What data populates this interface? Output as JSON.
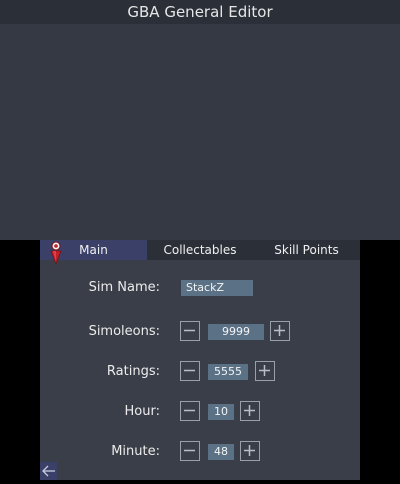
{
  "app": {
    "title": "GBA General Editor"
  },
  "tabs": [
    {
      "label": "Main",
      "active": true
    },
    {
      "label": "Collectables",
      "active": false
    },
    {
      "label": "Skill Points",
      "active": false
    }
  ],
  "form": {
    "sim_name": {
      "label": "Sim Name:",
      "value": "StackZ"
    },
    "simoleons": {
      "label": "Simoleons:",
      "value": "9999"
    },
    "ratings": {
      "label": "Ratings:",
      "value": "5555"
    },
    "hour": {
      "label": "Hour:",
      "value": "10"
    },
    "minute": {
      "label": "Minute:",
      "value": "48"
    }
  },
  "icons": {
    "decrement": "minus-icon",
    "increment": "plus-icon",
    "back": "back-arrow-icon",
    "mascot": "plumbob-mascot-icon"
  },
  "colors": {
    "accent": "#3b4069",
    "field": "#5b7186",
    "panel": "#3a3e48"
  }
}
